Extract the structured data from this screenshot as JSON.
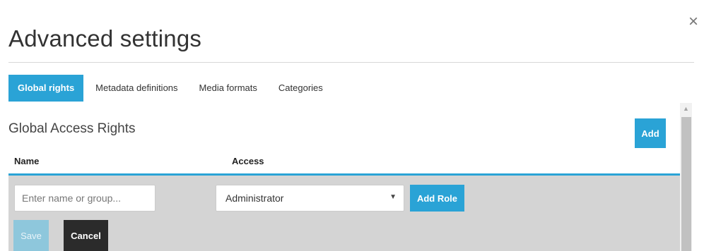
{
  "dialog": {
    "title": "Advanced settings",
    "close_glyph": "×"
  },
  "tabs": [
    {
      "label": "Global rights",
      "active": true
    },
    {
      "label": "Metadata definitions",
      "active": false
    },
    {
      "label": "Media formats",
      "active": false
    },
    {
      "label": "Categories",
      "active": false
    }
  ],
  "section": {
    "title": "Global Access Rights",
    "add_label": "Add"
  },
  "table": {
    "columns": [
      "Name",
      "Access"
    ]
  },
  "editor": {
    "name_placeholder": "Enter name or group...",
    "name_value": "",
    "access_value": "Administrator",
    "add_role_label": "Add Role",
    "save_label": "Save",
    "cancel_label": "Cancel"
  },
  "icons": {
    "close": "close-icon",
    "select_caret": "caret-down-icon",
    "scroll_up": "scroll-up-arrow-icon"
  },
  "colors": {
    "accent": "#2aa3d6",
    "edit_row": "#d4d4d4",
    "cancel": "#2b2b2b",
    "save_disabled": "#8ec7dc"
  }
}
